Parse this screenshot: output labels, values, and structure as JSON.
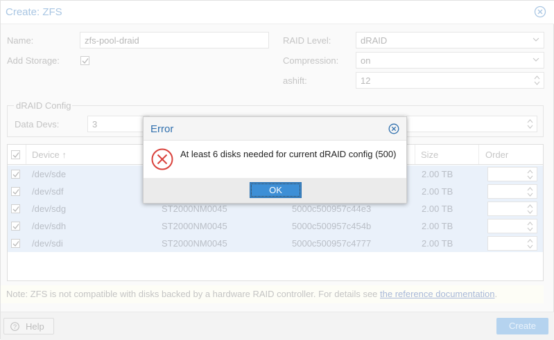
{
  "window": {
    "title": "Create: ZFS"
  },
  "form": {
    "name_label": "Name:",
    "name_value": "zfs-pool-draid",
    "add_storage_label": "Add Storage:",
    "raid_level_label": "RAID Level:",
    "raid_level_value": "dRAID",
    "compression_label": "Compression:",
    "compression_value": "on",
    "ashift_label": "ashift:",
    "ashift_value": "12"
  },
  "draid_config": {
    "legend": "dRAID Config",
    "data_devs_label": "Data Devs:",
    "data_devs_value": "3"
  },
  "disk_grid": {
    "columns": [
      "Device",
      "Size",
      "Order"
    ],
    "sort_indicator": "↑",
    "rows": [
      {
        "device": "/dev/sde",
        "model": "",
        "serial": "",
        "size": "2.00 TB",
        "checked": true
      },
      {
        "device": "/dev/sdf",
        "model": "",
        "serial": "",
        "size": "2.00 TB",
        "checked": true
      },
      {
        "device": "/dev/sdg",
        "model": "ST2000NM0045",
        "serial": "5000c500957c44e3",
        "size": "2.00 TB",
        "checked": true
      },
      {
        "device": "/dev/sdh",
        "model": "ST2000NM0045",
        "serial": "5000c500957c454b",
        "size": "2.00 TB",
        "checked": true
      },
      {
        "device": "/dev/sdi",
        "model": "ST2000NM0045",
        "serial": "5000c500957c4777",
        "size": "2.00 TB",
        "checked": true
      }
    ]
  },
  "note": {
    "text": "Note: ZFS is not compatible with disks backed by a hardware RAID controller. For details see ",
    "link": "the reference documentation",
    "end": "."
  },
  "footer": {
    "help_label": "Help",
    "create_label": "Create"
  },
  "error_dialog": {
    "title": "Error",
    "message": "At least 6 disks needed for current dRAID config (500)",
    "ok_label": "OK"
  },
  "colors": {
    "accent": "#3d8fd6",
    "error_red": "#d9413b",
    "title_blue": "#2f6fad"
  }
}
